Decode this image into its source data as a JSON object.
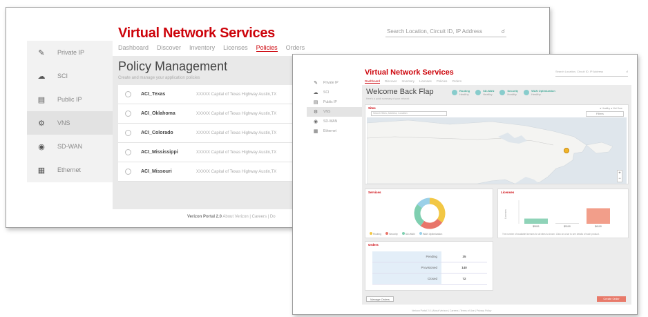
{
  "back": {
    "title": "Virtual Network Services",
    "search_placeholder": "Search Location, Circuit ID, IP Address",
    "tabs": [
      "Dashboard",
      "Discover",
      "Inventory",
      "Licenses",
      "Policies",
      "Orders"
    ],
    "active_tab": 4,
    "sidebar": [
      {
        "label": "Private IP",
        "icon": "wrench-icon"
      },
      {
        "label": "SCI",
        "icon": "cloud-icon"
      },
      {
        "label": "Public IP",
        "icon": "server-icon"
      },
      {
        "label": "VNS",
        "icon": "gear-icon"
      },
      {
        "label": "SD-WAN",
        "icon": "globe-icon"
      },
      {
        "label": "Ethernet",
        "icon": "network-icon"
      }
    ],
    "active_sidebar": 3,
    "heading": "Policy Management",
    "subheading": "Create and manage your application policies",
    "rows": [
      {
        "name": "ACI_Texas",
        "address": "XXXXX Capital of Texas Highway Austin,TX"
      },
      {
        "name": "ACI_Oklahoma",
        "address": "XXXXX Capital of Texas Highway Austin,TX"
      },
      {
        "name": "ACI_Colorado",
        "address": "XXXXX Capital of Texas Highway Austin,TX"
      },
      {
        "name": "ACI_Mississippi",
        "address": "XXXXX Capital of Texas Highway Austin,TX"
      },
      {
        "name": "ACI_Missouri",
        "address": "XXXXX Capital of Texas Highway Austin,TX"
      }
    ],
    "more_label": "M",
    "footer_brand": "Verizon Portal 2.0",
    "footer_text": "About Verizon | Careers | Do"
  },
  "front": {
    "title": "Virtual Network Services",
    "search_placeholder": "Search Location, Circuit ID, IP Address",
    "tabs": [
      "Dashboard",
      "Discover",
      "Inventory",
      "Licenses",
      "Policies",
      "Orders"
    ],
    "active_tab": 0,
    "sidebar": [
      {
        "label": "Private IP",
        "icon": "wrench-icon"
      },
      {
        "label": "SCI",
        "icon": "cloud-icon"
      },
      {
        "label": "Public IP",
        "icon": "server-icon"
      },
      {
        "label": "VNS",
        "icon": "gear-icon"
      },
      {
        "label": "SD-WAN",
        "icon": "globe-icon"
      },
      {
        "label": "Ethernet",
        "icon": "network-icon"
      }
    ],
    "active_sidebar": 3,
    "welcome": "Welcome Back Flap",
    "welcome_sub": "Here's a quick summary of your network",
    "stats": [
      {
        "title": "Routing",
        "sub": "Healthy"
      },
      {
        "title": "SD-WAN",
        "sub": "Healthy"
      },
      {
        "title": "Security",
        "sub": "Healthy"
      },
      {
        "title": "WAN Optimization",
        "sub": "Healthy"
      }
    ],
    "map": {
      "header": "Sites",
      "search_placeholder": "Search Sites, Address, Location",
      "legend": "● Healthy   ● Not Sure",
      "select": "Filters",
      "zoom_in": "+",
      "zoom_out": "−"
    },
    "services": {
      "header": "Services",
      "legend": [
        "Routing",
        "Security",
        "SD-WAN",
        "WAN Optimization"
      ],
      "colors": [
        "#f2c744",
        "#e8756a",
        "#7fcfb0",
        "#9ad0e8"
      ],
      "values": [
        35,
        25,
        25,
        15
      ]
    },
    "licenses": {
      "header": "Licenses",
      "ylabel": "Licenses",
      "categories": [
        "$5001",
        "$5100",
        "$6100"
      ],
      "values": [
        1,
        0,
        3
      ],
      "colors": [
        "#8fd3b8",
        "#cccccc",
        "#f29e8a"
      ],
      "note": "The number of available licenses for all sites is shown. Click on a bar to see details of each product."
    },
    "orders": {
      "header": "Orders",
      "rows": [
        {
          "label": "Pending",
          "value": "35"
        },
        {
          "label": "Provisioned",
          "value": "140"
        },
        {
          "label": "Closed",
          "value": "72"
        }
      ]
    },
    "manage_button": "Manage Orders",
    "cta_button": "Create Order",
    "footer": "Verizon Portal 2.0 | About Verizon | Careers | Terms of Use | Privacy Policy"
  }
}
